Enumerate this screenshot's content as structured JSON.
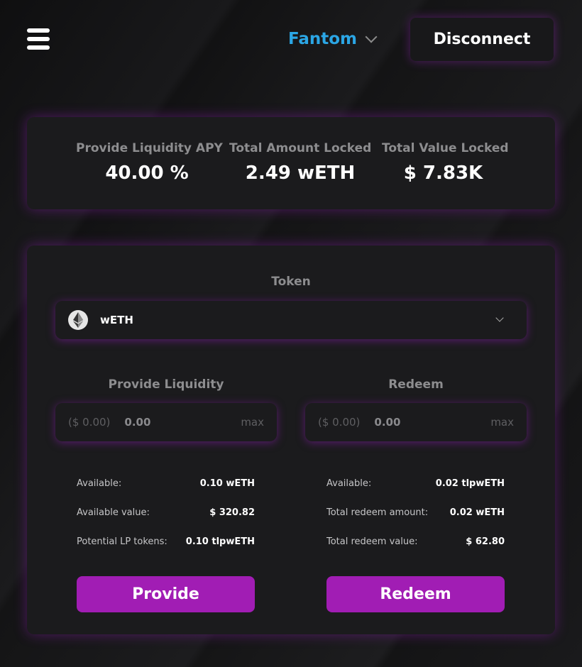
{
  "header": {
    "network": "Fantom",
    "disconnect_label": "Disconnect"
  },
  "stats": [
    {
      "label": "Provide Liquidity APY",
      "value": "40.00 %"
    },
    {
      "label": "Total Amount Locked",
      "value": "2.49 wETH"
    },
    {
      "label": "Total Value Locked",
      "value": "$ 7.83K"
    }
  ],
  "token": {
    "label": "Token",
    "selected": "wETH",
    "icon": "ethereum-icon"
  },
  "provide": {
    "label": "Provide Liquidity",
    "usd": "($ 0.00)",
    "amount": "0.00",
    "max_label": "max",
    "rows": [
      {
        "key": "Available:",
        "value": "0.10 wETH"
      },
      {
        "key": "Available value:",
        "value": "$ 320.82"
      },
      {
        "key": "Potential LP tokens:",
        "value": "0.10 tlpwETH"
      }
    ],
    "button": "Provide"
  },
  "redeem": {
    "label": "Redeem",
    "usd": "($ 0.00)",
    "amount": "0.00",
    "max_label": "max",
    "rows": [
      {
        "key": "Available:",
        "value": "0.02 tlpwETH"
      },
      {
        "key": "Total redeem amount:",
        "value": "0.02 wETH"
      },
      {
        "key": "Total redeem value:",
        "value": "$ 62.80"
      }
    ],
    "button": "Redeem"
  },
  "colors": {
    "accent": "#a11db4",
    "network": "#2ba6e5",
    "background": "#141416",
    "card": "#1b1b1d"
  }
}
